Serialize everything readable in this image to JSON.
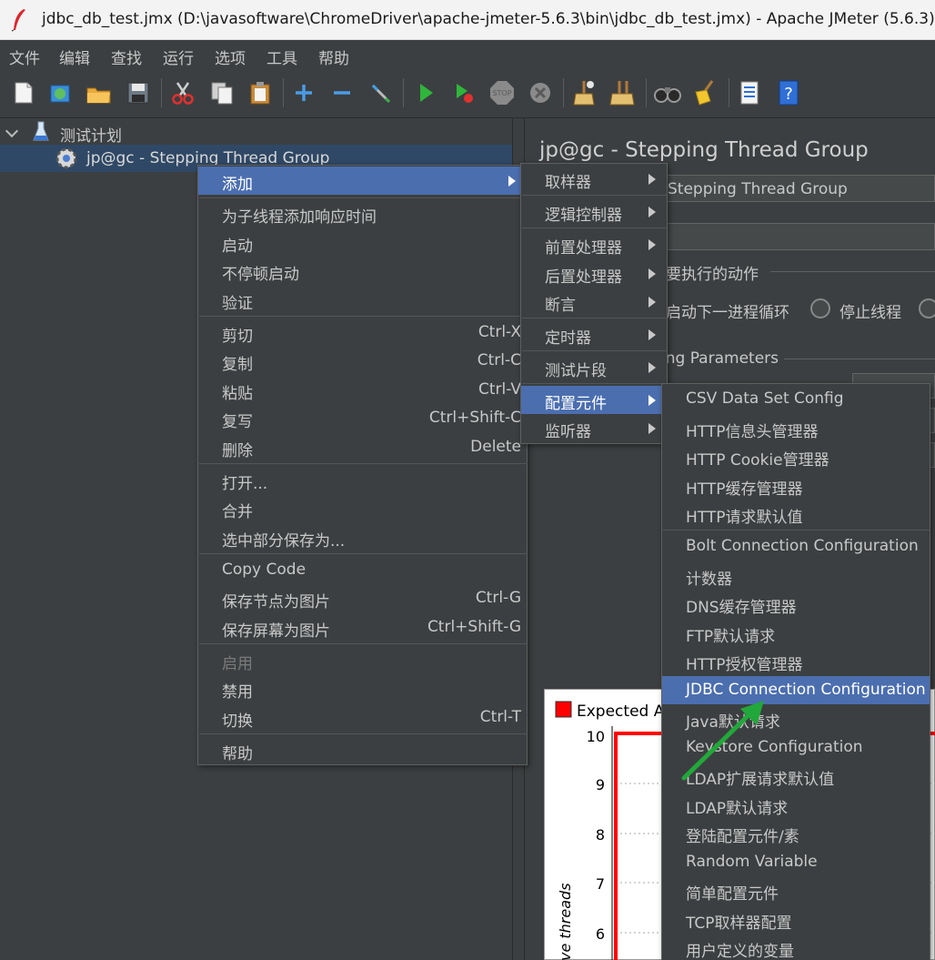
{
  "window": {
    "title": "jdbc_db_test.jmx (D:\\javasoftware\\ChromeDriver\\apache-jmeter-5.6.3\\bin\\jdbc_db_test.jmx) - Apache JMeter (5.6.3)"
  },
  "menubar": [
    "文件",
    "编辑",
    "查找",
    "运行",
    "选项",
    "工具",
    "帮助"
  ],
  "toolbar": {
    "icons": [
      "new-icon",
      "templates-icon",
      "open-icon",
      "save-icon",
      "cut-icon",
      "copy-icon",
      "paste-icon",
      "expand-icon",
      "collapse-icon",
      "toggle-icon",
      "start-icon",
      "start-no-pause-icon",
      "stop-icon",
      "shutdown-icon",
      "clear-icon",
      "clear-all-icon",
      "search-icon",
      "reset-search-icon",
      "function-helper-icon",
      "help-icon"
    ]
  },
  "tree": {
    "root_label": "测试计划",
    "child_label": "jp@gc - Stepping Thread Group"
  },
  "right_panel": {
    "heading": "jp@gc - Stepping Thread Group",
    "name_value": "Stepping Thread Group",
    "action_title": "要执行的动作",
    "radio_next_loop": "启动下一进程循环",
    "radio_stop_thread": "停止线程",
    "params_title": "ing Parameters"
  },
  "context_menu": {
    "items": [
      {
        "label": "添加",
        "submenu": true,
        "highlight": true
      },
      {
        "label": "为子线程添加响应时间"
      },
      {
        "label": "启动"
      },
      {
        "label": "不停顿启动"
      },
      {
        "label": "验证"
      },
      {
        "label": "剪切",
        "shortcut": "Ctrl-X"
      },
      {
        "label": "复制",
        "shortcut": "Ctrl-C"
      },
      {
        "label": "粘贴",
        "shortcut": "Ctrl-V"
      },
      {
        "label": "复写",
        "shortcut": "Ctrl+Shift-C"
      },
      {
        "label": "删除",
        "shortcut": "Delete"
      },
      {
        "label": "打开..."
      },
      {
        "label": "合并"
      },
      {
        "label": "选中部分保存为..."
      },
      {
        "label": "Copy Code"
      },
      {
        "label": "保存节点为图片",
        "shortcut": "Ctrl-G"
      },
      {
        "label": "保存屏幕为图片",
        "shortcut": "Ctrl+Shift-G"
      },
      {
        "label": "启用",
        "disabled": true
      },
      {
        "label": "禁用"
      },
      {
        "label": "切换",
        "shortcut": "Ctrl-T"
      },
      {
        "label": "帮助"
      }
    ]
  },
  "add_menu": {
    "items": [
      {
        "label": "取样器"
      },
      {
        "label": "逻辑控制器"
      },
      {
        "label": "前置处理器"
      },
      {
        "label": "后置处理器"
      },
      {
        "label": "断言"
      },
      {
        "label": "定时器"
      },
      {
        "label": "测试片段"
      },
      {
        "label": "配置元件",
        "highlight": true
      },
      {
        "label": "监听器"
      }
    ]
  },
  "config_menu": {
    "items": [
      {
        "label": "CSV Data Set Config"
      },
      {
        "label": "HTTP信息头管理器"
      },
      {
        "label": "HTTP Cookie管理器"
      },
      {
        "label": "HTTP缓存管理器"
      },
      {
        "label": "HTTP请求默认值"
      },
      {
        "label": "Bolt Connection Configuration"
      },
      {
        "label": "计数器"
      },
      {
        "label": "DNS缓存管理器"
      },
      {
        "label": "FTP默认请求"
      },
      {
        "label": "HTTP授权管理器"
      },
      {
        "label": "JDBC Connection Configuration",
        "highlight": true
      },
      {
        "label": "Java默认请求"
      },
      {
        "label": "Keystore Configuration"
      },
      {
        "label": "LDAP扩展请求默认值"
      },
      {
        "label": "LDAP默认请求"
      },
      {
        "label": "登陆配置元件/素"
      },
      {
        "label": "Random Variable"
      },
      {
        "label": "简单配置元件"
      },
      {
        "label": "TCP取样器配置"
      },
      {
        "label": "用户定义的变量"
      }
    ]
  },
  "chart_data": {
    "type": "line",
    "legend": [
      "Expected Ac"
    ],
    "ylabel": "ve threads",
    "yticks": [
      10,
      9,
      8,
      7,
      6
    ],
    "series_color": "#ff0000"
  },
  "colors": {
    "highlight": "#4b6eaf",
    "selected_tree_row": "#2f4865",
    "annotation_arrow": "#22a83a"
  }
}
